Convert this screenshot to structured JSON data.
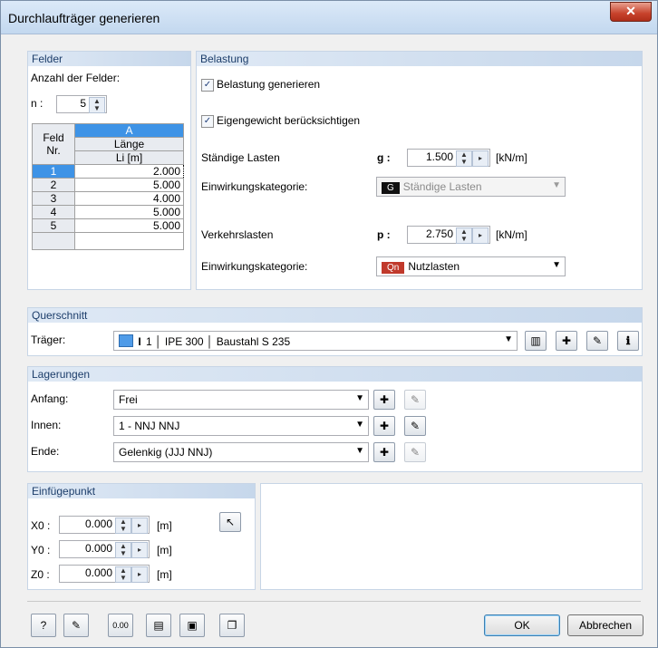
{
  "window": {
    "title": "Durchlaufträger generieren",
    "close_icon": "close-icon"
  },
  "felder": {
    "header": "Felder",
    "count_label": "Anzahl der Felder:",
    "n_label": "n :",
    "n_value": "5",
    "col_letter": "A",
    "col1_header_1": "Feld",
    "col1_header_2": "Nr.",
    "col2_header_1": "Länge",
    "col2_header_2": "Li [m]",
    "rows": [
      {
        "nr": "1",
        "len": "2.000"
      },
      {
        "nr": "2",
        "len": "5.000"
      },
      {
        "nr": "3",
        "len": "4.000"
      },
      {
        "nr": "4",
        "len": "5.000"
      },
      {
        "nr": "5",
        "len": "5.000"
      }
    ]
  },
  "belastung": {
    "header": "Belastung",
    "generate_label": "Belastung generieren",
    "selfweight_label": "Eigengewicht berücksichtigen",
    "g_row_label": "Ständige Lasten",
    "g_symbol": "g :",
    "g_value": "1.500",
    "g_unit": "[kN/m]",
    "cat1_label": "Einwirkungskategorie:",
    "cat1_badge": "G",
    "cat1_value": "Ständige Lasten",
    "p_row_label": "Verkehrslasten",
    "p_symbol": "p :",
    "p_value": "2.750",
    "p_unit": "[kN/m]",
    "cat2_label": "Einwirkungskategorie:",
    "cat2_badge": "Qn",
    "cat2_value": "Nutzlasten",
    "colors": {
      "g_badge": "#111111",
      "qn_badge": "#c0392b"
    }
  },
  "querschnitt": {
    "header": "Querschnitt",
    "traeger_label": "Träger:",
    "traeger_value": "1 │ IPE 300 │ Baustahl S 235"
  },
  "lagerungen": {
    "header": "Lagerungen",
    "anfang_label": "Anfang:",
    "anfang_value": "Frei",
    "innen_label": "Innen:",
    "innen_value": "1 - NNJ NNJ",
    "ende_label": "Ende:",
    "ende_value": "Gelenkig (JJJ NNJ)"
  },
  "einfuegepunkt": {
    "header": "Einfügepunkt",
    "x_label": "X0 :",
    "x_value": "0.000",
    "y_label": "Y0 :",
    "y_value": "0.000",
    "z_label": "Z0 :",
    "z_value": "0.000",
    "unit": "[m]"
  },
  "footer": {
    "ok_label": "OK",
    "cancel_label": "Abbrechen"
  }
}
